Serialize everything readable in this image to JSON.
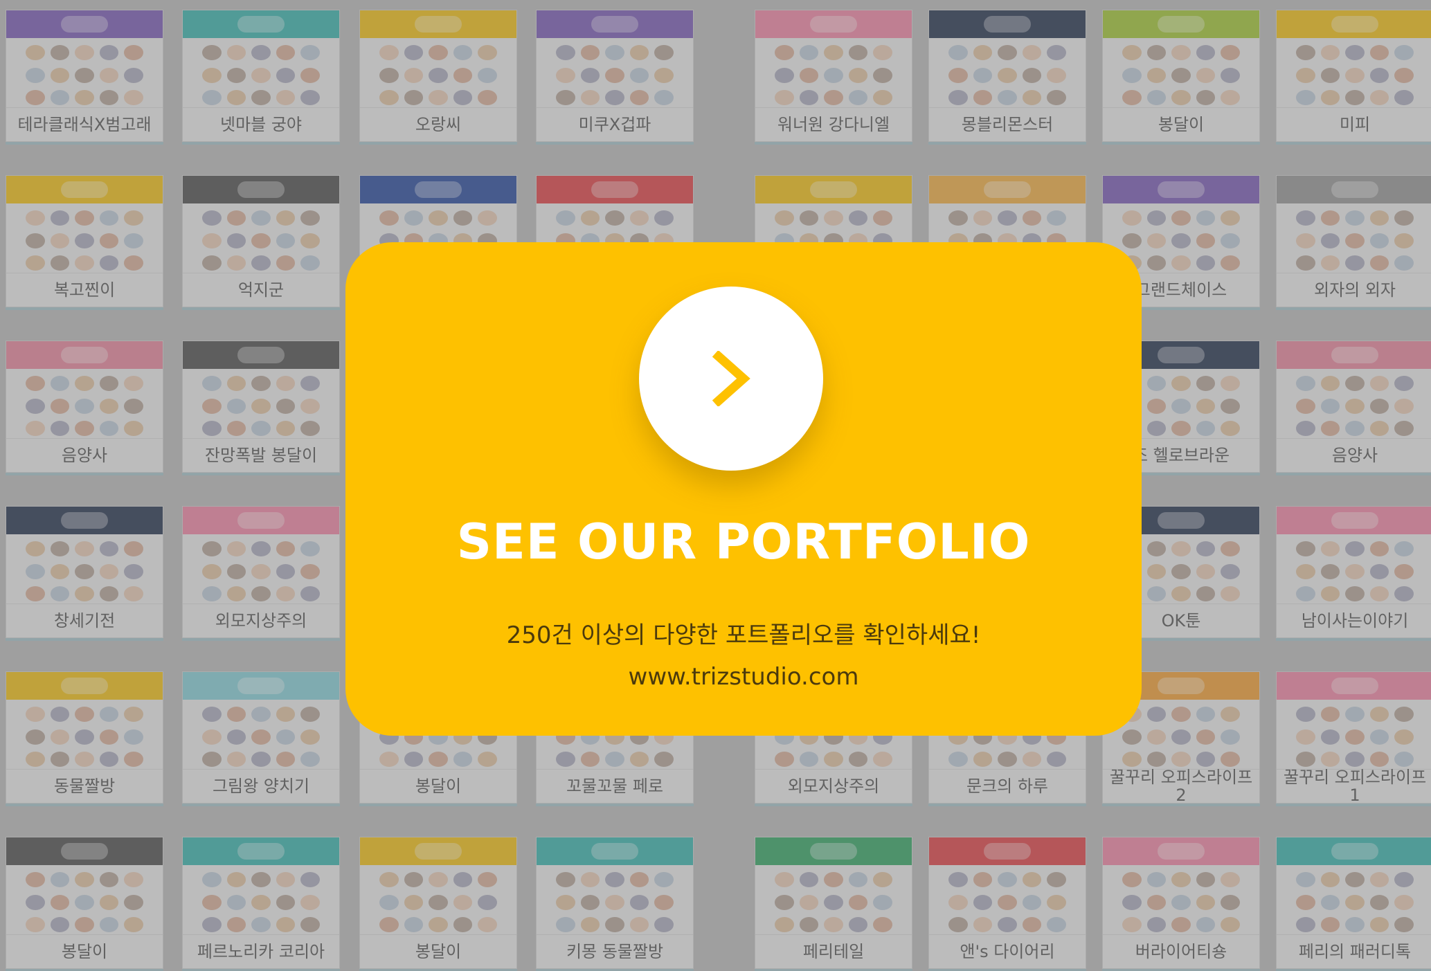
{
  "background_cards": [
    {
      "title": "테라클래식X범고래",
      "banner": "#7f5fb8"
    },
    {
      "title": "넷마블 궁야",
      "banner": "#3fb6b0"
    },
    {
      "title": "오랑씨",
      "banner": "#f2c21c"
    },
    {
      "title": "미쿠X겁파",
      "banner": "#7f5fb8"
    },
    {
      "title": "워너원 강다니엘",
      "banner": "#f08aa8"
    },
    {
      "title": "몽블리몬스터",
      "banner": "#2d3a55"
    },
    {
      "title": "봉달이",
      "banner": "#a5c83a"
    },
    {
      "title": "미피",
      "banner": "#f2c21c"
    },
    {
      "title": "복고찐이",
      "banner": "#f2c21c"
    },
    {
      "title": "억지군",
      "banner": "#555555"
    },
    {
      "title": "",
      "banner": "#2f4fa0"
    },
    {
      "title": "",
      "banner": "#e0474c"
    },
    {
      "title": "",
      "banner": "#f2c21c"
    },
    {
      "title": "",
      "banner": "#f0b04a"
    },
    {
      "title": "그랜드체이스",
      "banner": "#7f5fb8"
    },
    {
      "title": "외자의 외자",
      "banner": "#9a9a9a"
    },
    {
      "title": "음양사",
      "banner": "#e88aa0"
    },
    {
      "title": "잔망폭발 봉달이",
      "banner": "#555555"
    },
    {
      "title": "",
      "banner": "#cccccc"
    },
    {
      "title": "",
      "banner": "#cccccc"
    },
    {
      "title": "",
      "banner": "#cccccc"
    },
    {
      "title": "",
      "banner": "#cccccc"
    },
    {
      "title": "조 헬로브라운",
      "banner": "#2d3a55"
    },
    {
      "title": "음양사",
      "banner": "#e88aa0"
    },
    {
      "title": "창세기전",
      "banner": "#2d3a55"
    },
    {
      "title": "외모지상주의",
      "banner": "#f08aa8"
    },
    {
      "title": "",
      "banner": "#cccccc"
    },
    {
      "title": "",
      "banner": "#cccccc"
    },
    {
      "title": "",
      "banner": "#cccccc"
    },
    {
      "title": "",
      "banner": "#cccccc"
    },
    {
      "title": "OK툰",
      "banner": "#2d3a55"
    },
    {
      "title": "남이사는이야기",
      "banner": "#f08aa8"
    },
    {
      "title": "동물짤방",
      "banner": "#f2c21c"
    },
    {
      "title": "그림왕 양치기",
      "banner": "#8ad0d8"
    },
    {
      "title": "봉달이",
      "banner": "#cccccc"
    },
    {
      "title": "꼬물꼬물 페로",
      "banner": "#cccccc"
    },
    {
      "title": "외모지상주의",
      "banner": "#cccccc"
    },
    {
      "title": "문크의 하루",
      "banner": "#cccccc"
    },
    {
      "title": "꿀꾸리 오피스라이프 2",
      "banner": "#f2a23a"
    },
    {
      "title": "꿀꾸리 오피스라이프 1",
      "banner": "#f08aa8"
    },
    {
      "title": "봉달이",
      "banner": "#555555"
    },
    {
      "title": "페르노리카 코리아",
      "banner": "#3fb6b0"
    },
    {
      "title": "봉달이",
      "banner": "#f2c21c"
    },
    {
      "title": "키몽 동물짤방",
      "banner": "#3fb6b0"
    },
    {
      "title": "페리테일",
      "banner": "#3aa86a"
    },
    {
      "title": "앤's 다이어리",
      "banner": "#e0474c"
    },
    {
      "title": "버라이어티숑",
      "banner": "#f08aa8"
    },
    {
      "title": "페리의 패러디톡",
      "banner": "#3fb6b0"
    }
  ],
  "modal": {
    "title": "SEE OUR PORTFOLIO",
    "subtitle": "250건 이상의 다양한 포트폴리오를 확인하세요!",
    "url": "www.trizstudio.com",
    "arrow_icon": "chevron-right-icon",
    "accent": "#fec100"
  }
}
